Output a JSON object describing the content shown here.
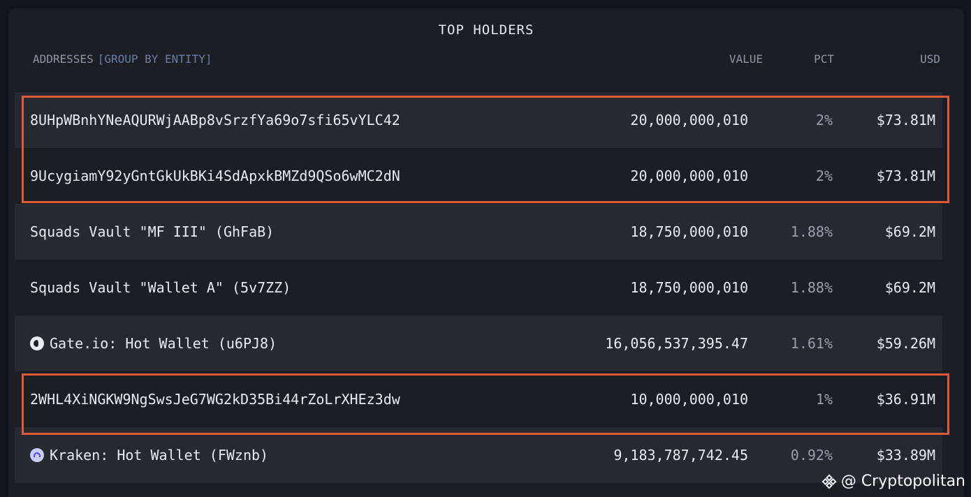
{
  "title": "TOP HOLDERS",
  "header": {
    "addresses": "ADDRESSES",
    "group_by": "[GROUP BY ENTITY]",
    "value": "VALUE",
    "pct": "PCT",
    "usd": "USD"
  },
  "rows": [
    {
      "address": "8UHpWBnhYNeAQURWjAABp8vSrzfYa69o7sfi65vYLC42",
      "value": "20,000,000,010",
      "pct": "2%",
      "usd": "$73.81M",
      "icon": "",
      "highlighted": true
    },
    {
      "address": "9UcygiamY92yGntGkUkBKi4SdApxkBMZd9QSo6wMC2dN",
      "value": "20,000,000,010",
      "pct": "2%",
      "usd": "$73.81M",
      "icon": "",
      "highlighted": true
    },
    {
      "address": "Squads Vault \"MF III\" (GhFaB)",
      "value": "18,750,000,010",
      "pct": "1.88%",
      "usd": "$69.2M",
      "icon": "",
      "highlighted": false
    },
    {
      "address": "Squads Vault \"Wallet A\" (5v7ZZ)",
      "value": "18,750,000,010",
      "pct": "1.88%",
      "usd": "$69.2M",
      "icon": "",
      "highlighted": false
    },
    {
      "address": "Gate.io: Hot Wallet (u6PJ8)",
      "value": "16,056,537,395.47",
      "pct": "1.61%",
      "usd": "$59.26M",
      "icon": "gate-io-icon",
      "highlighted": false
    },
    {
      "address": "2WHL4XiNGKW9NgSwsJeG7WG2kD35Bi44rZoLrXHEz3dw",
      "value": "10,000,000,010",
      "pct": "1%",
      "usd": "$36.91M",
      "icon": "",
      "highlighted": true
    },
    {
      "address": "Kraken: Hot Wallet (FWznb)",
      "value": "9,183,787,742.45",
      "pct": "0.92%",
      "usd": "$33.89M",
      "icon": "kraken-icon",
      "highlighted": false
    }
  ],
  "watermark": "@ Cryptopolitan",
  "colors": {
    "highlight_border": "#e05a3a",
    "group_by_link": "#6c7ea7"
  }
}
